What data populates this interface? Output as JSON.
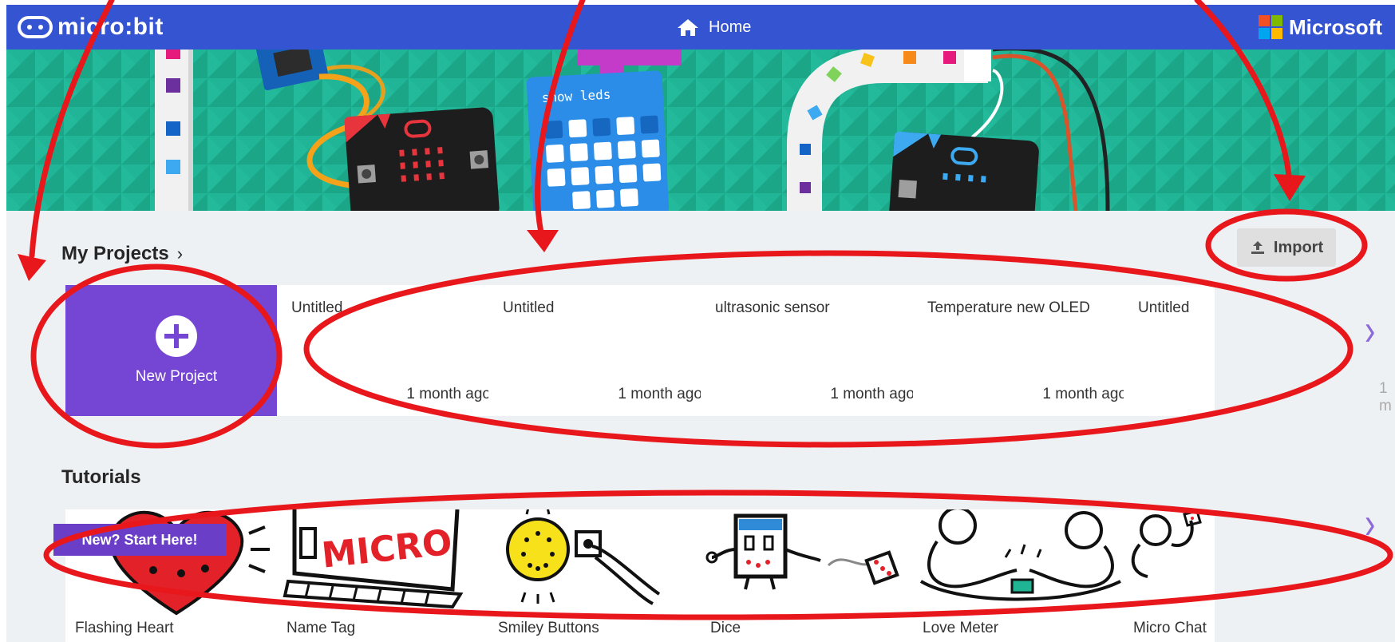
{
  "header": {
    "logo_text": "micro:bit",
    "home_label": "Home",
    "ms_label": "Microsoft",
    "ms_colors": [
      "#f25022",
      "#7fba00",
      "#00a4ef",
      "#ffb900"
    ]
  },
  "hero": {
    "show_leds": "show leds"
  },
  "projects": {
    "title": "My Projects",
    "chevron": "›",
    "import_label": "Import",
    "new_project_label": "New Project",
    "items": [
      {
        "name": "Untitled",
        "time": "1 month ago"
      },
      {
        "name": "Untitled",
        "time": "1 month ago"
      },
      {
        "name": "ultrasonic sensor",
        "time": "1 month ago"
      },
      {
        "name": "Temperature new OLED",
        "time": "1 month ago"
      },
      {
        "name": "Untitled",
        "time": "1 m"
      }
    ],
    "next_arrow": "›"
  },
  "tutorials": {
    "title": "Tutorials",
    "start_badge": "New? Start Here!",
    "items": [
      {
        "name": "Flashing Heart"
      },
      {
        "name": "Name Tag",
        "image_text": "MICRO"
      },
      {
        "name": "Smiley Buttons"
      },
      {
        "name": "Dice"
      },
      {
        "name": "Love Meter"
      },
      {
        "name": "Micro Chat"
      }
    ],
    "next_arrow": "›"
  },
  "colors": {
    "topbar": "#3454d1",
    "accent_purple": "#7546d3",
    "hero_teal": "#1fb494",
    "annotation_red": "#e8171c"
  }
}
